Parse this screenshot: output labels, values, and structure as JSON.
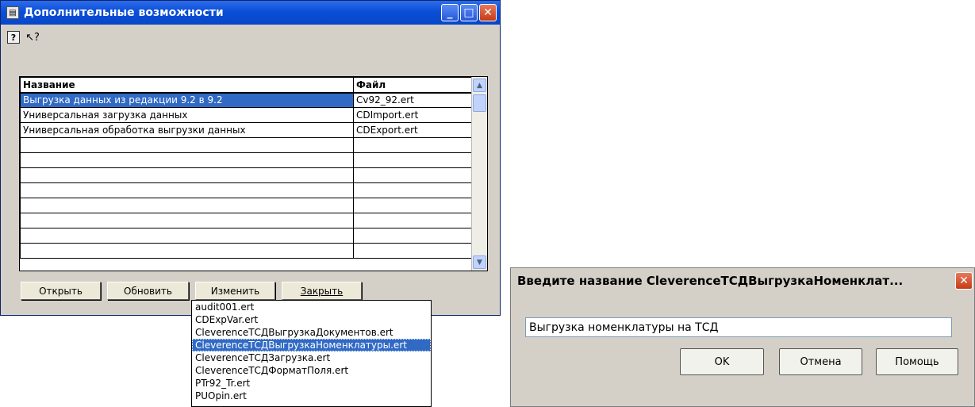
{
  "main_window": {
    "title": "Дополнительные возможности",
    "minimize": "_",
    "maximize": "□",
    "close": "✕",
    "toolbar": {
      "help_glyph": "?",
      "context_help_glyph": "↖?"
    },
    "table": {
      "headers": [
        "Название",
        "Файл"
      ],
      "rows": [
        {
          "name": "Выгрузка данных из редакции 9.2 в 9.2",
          "file": "Cv92_92.ert",
          "selected": true
        },
        {
          "name": "Универсальная загрузка данных",
          "file": "CDImport.ert"
        },
        {
          "name": "Универсальная обработка выгрузки данных",
          "file": "CDExport.ert"
        }
      ]
    },
    "buttons": {
      "open": "Открыть",
      "refresh": "Обновить",
      "edit": "Изменить",
      "close": "Закрыть"
    }
  },
  "file_dropdown": {
    "items": [
      "audit001.ert",
      "CDExpVar.ert",
      "CleverenceТСДВыгрузкаДокументов.ert",
      "CleverenceТСДВыгрузкаНоменклатуры.ert",
      "CleverenceТСДЗагрузка.ert",
      "CleverenceТСДФорматПоля.ert",
      "PTr92_Tr.ert",
      "PUOpin.ert"
    ],
    "selected_index": 3
  },
  "name_dialog": {
    "title": "Введите название CleverenceТСДВыгрузкаНоменклат...",
    "input_value": "Выгрузка номенклатуры на ТСД",
    "ok": "OK",
    "cancel": "Отмена",
    "help": "Помощь",
    "close": "✕"
  },
  "colors": {
    "titlebar": "#0a4fd8",
    "selection": "#316ac5",
    "dialog_face": "#d4d0c8"
  }
}
